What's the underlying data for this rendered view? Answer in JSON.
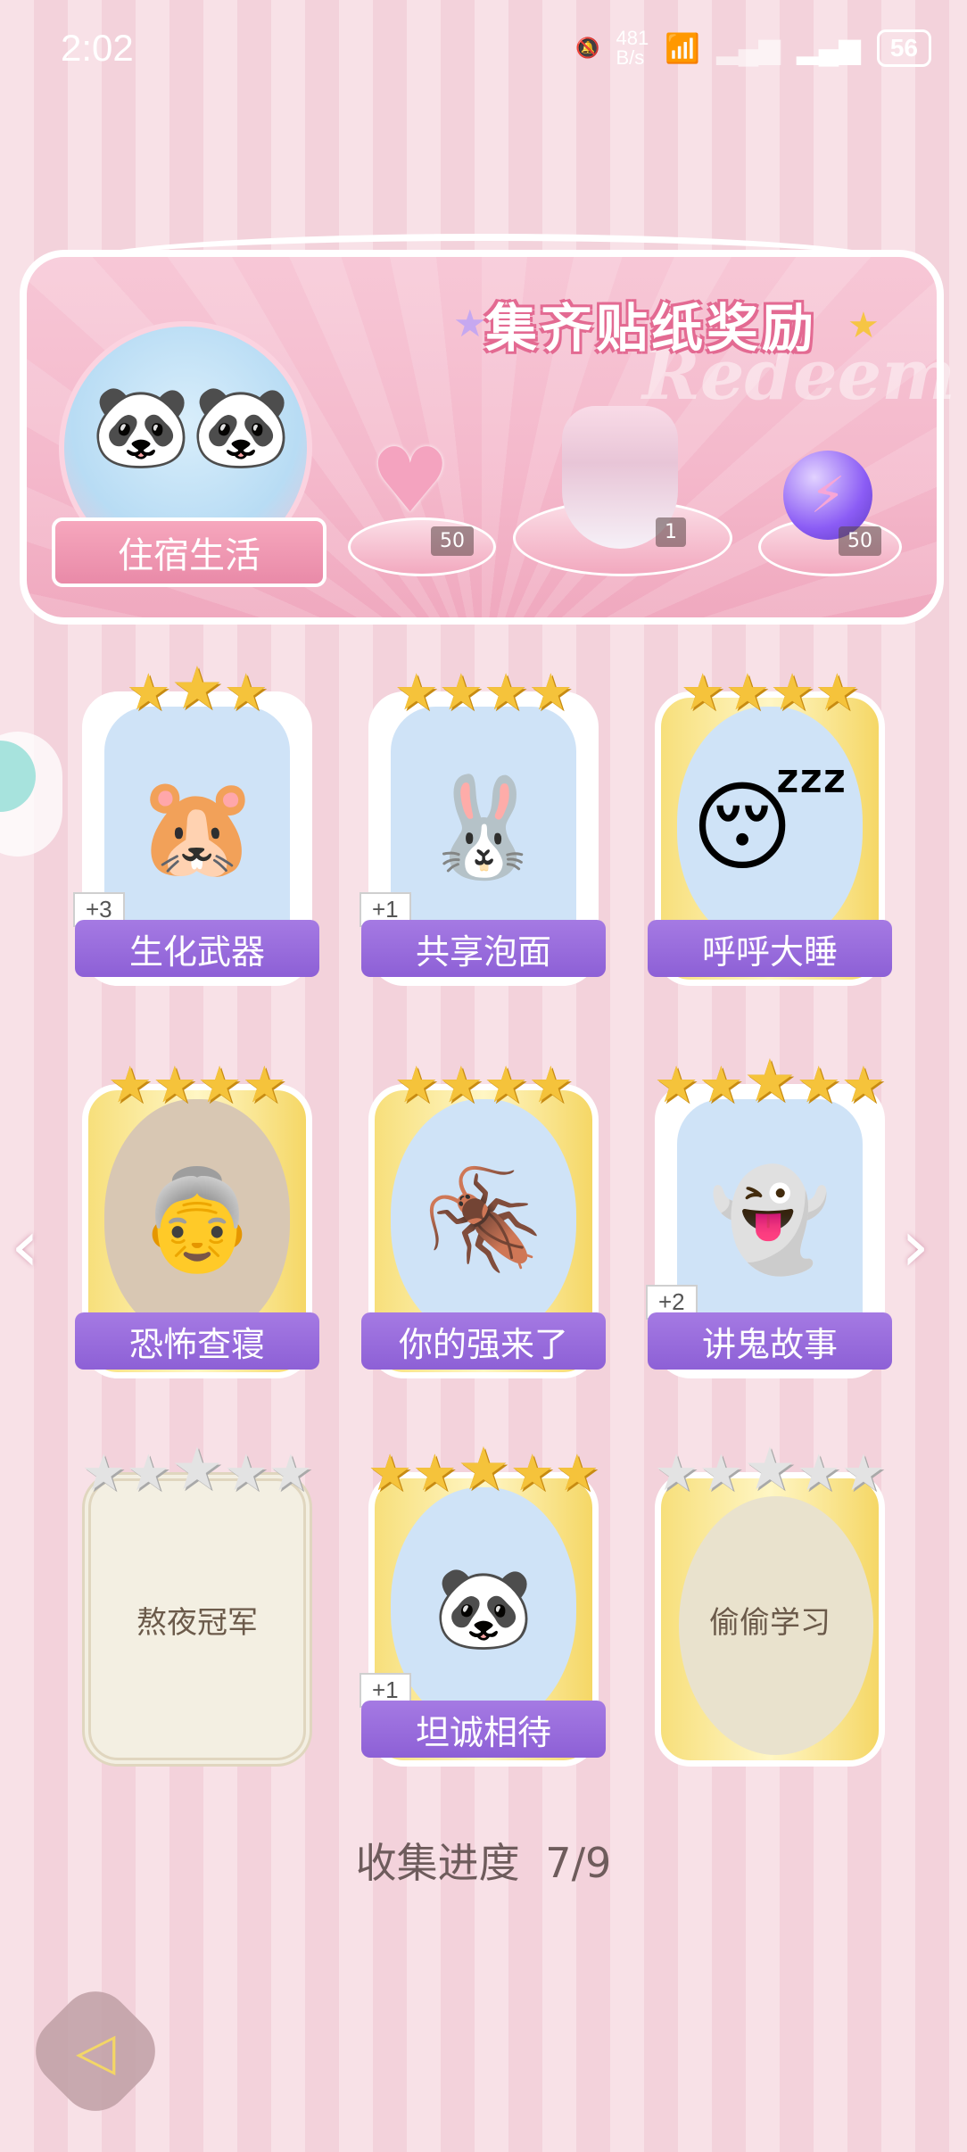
{
  "status_bar": {
    "time": "2:02",
    "net_speed_top": "481",
    "net_speed_bottom": "B/s",
    "battery": "56"
  },
  "banner": {
    "title": "集齐贴纸奖励",
    "watermark": "Redeem",
    "collection_name": "住宿生活",
    "rewards": [
      {
        "icon": "pink-heart-gem-icon",
        "count": "50"
      },
      {
        "icon": "white-dress-icon",
        "count": "1"
      },
      {
        "icon": "purple-lightning-orb-icon",
        "count": "50"
      }
    ]
  },
  "stickers": [
    {
      "name": "生化武器",
      "stars": 3,
      "badge": "+3",
      "collected": true,
      "art": "🐹"
    },
    {
      "name": "共享泡面",
      "stars": 4,
      "badge": "+1",
      "collected": true,
      "art": "🐰"
    },
    {
      "name": "呼呼大睡",
      "stars": 4,
      "badge": "",
      "collected": true,
      "art": "😴"
    },
    {
      "name": "恐怖查寝",
      "stars": 4,
      "badge": "",
      "collected": true,
      "art": "👵"
    },
    {
      "name": "你的强来了",
      "stars": 4,
      "badge": "",
      "collected": true,
      "art": "🪳"
    },
    {
      "name": "讲鬼故事",
      "stars": 5,
      "badge": "+2",
      "collected": true,
      "art": "👻"
    },
    {
      "name": "熬夜冠军",
      "stars": 5,
      "badge": "",
      "collected": false,
      "art": ""
    },
    {
      "name": "坦诚相待",
      "stars": 5,
      "badge": "+1",
      "collected": true,
      "art": "🐼"
    },
    {
      "name": "偷偷学习",
      "stars": 5,
      "badge": "",
      "collected": false,
      "art": ""
    }
  ],
  "progress": {
    "label": "收集进度",
    "value": "7/9"
  },
  "colors": {
    "label_purple": "#8d60d6",
    "star_gold": "#f5c33b",
    "banner_pink": "#f4b8cb"
  }
}
